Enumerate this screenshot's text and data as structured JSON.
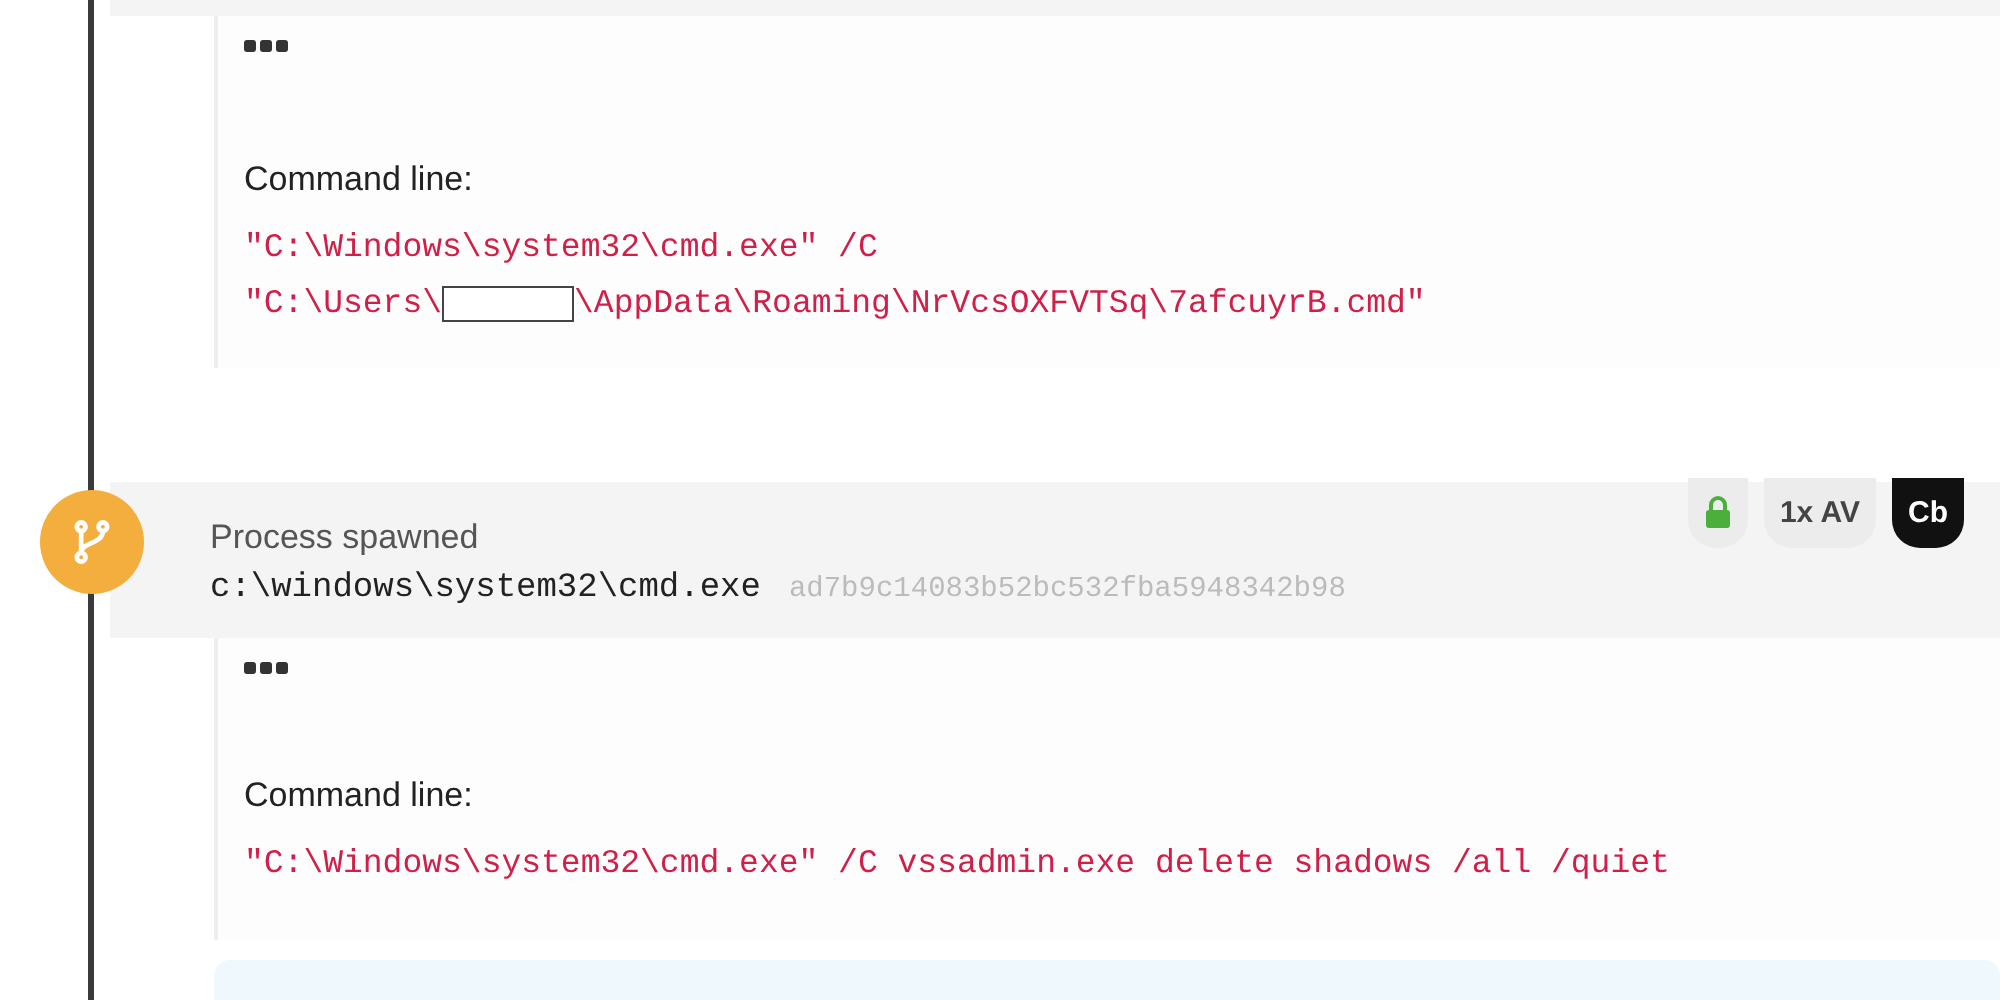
{
  "previous_event": {
    "details": {
      "label": "Command line:",
      "command_lines": [
        [
          {
            "kind": "text",
            "text": "\"C:\\Windows\\system32\\cmd.exe\" /C"
          }
        ],
        [
          {
            "kind": "text",
            "text": "\"C:\\Users\\"
          },
          {
            "kind": "redacted"
          },
          {
            "kind": "text",
            "text": "\\AppData\\Roaming\\NrVcsOXFVTSq\\7afcuyrB.cmd\""
          }
        ]
      ]
    }
  },
  "event": {
    "title": "Process spawned",
    "path": "c:\\windows\\system32\\cmd.exe",
    "hash": "ad7b9c14083b52bc532fba5948342b98",
    "badges": [
      {
        "kind": "lock"
      },
      {
        "kind": "text",
        "text": "1x AV"
      },
      {
        "kind": "dark",
        "text": "Cb"
      }
    ],
    "details": {
      "label": "Command line:",
      "command_lines": [
        [
          {
            "kind": "text",
            "text": "\"C:\\Windows\\system32\\cmd.exe\" /C vssadmin.exe delete shadows /all /quiet"
          }
        ]
      ]
    }
  }
}
